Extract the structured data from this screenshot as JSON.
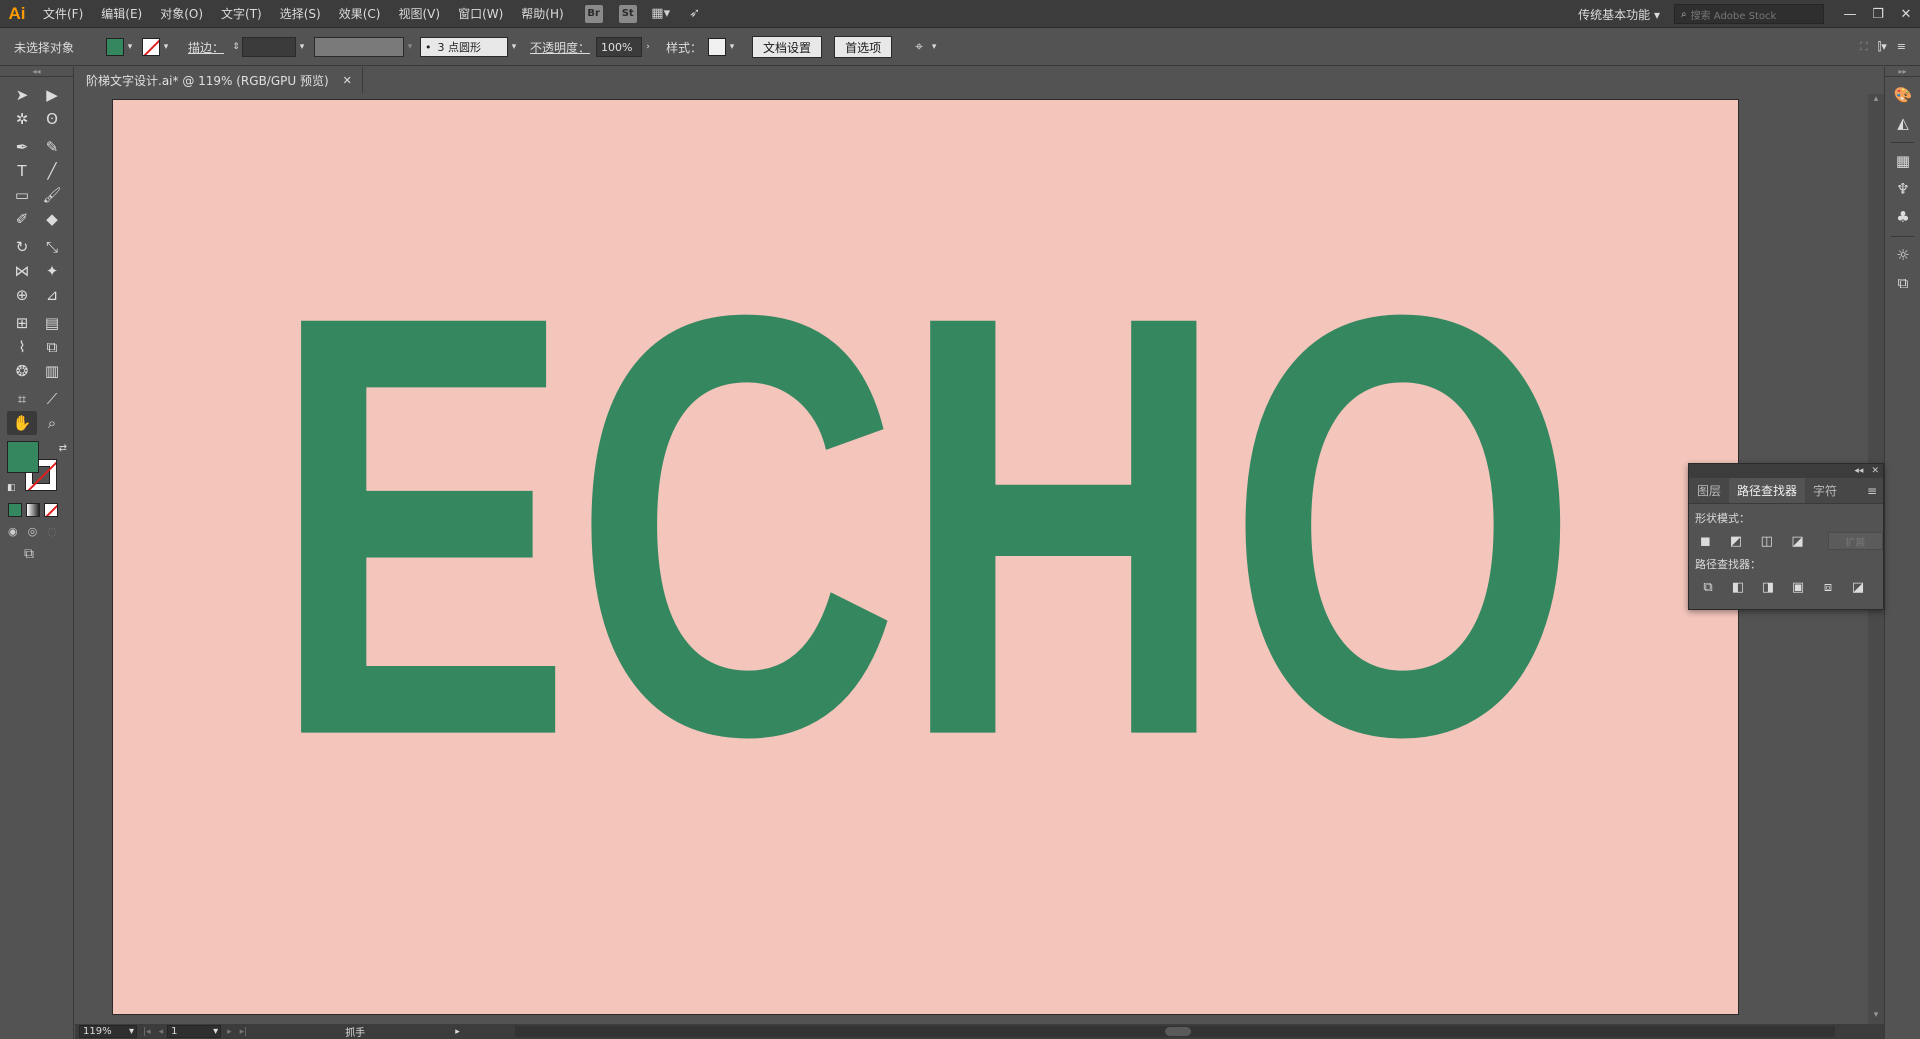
{
  "app": {
    "logo": "Ai"
  },
  "menu": {
    "items": [
      "文件(F)",
      "编辑(E)",
      "对象(O)",
      "文字(T)",
      "选择(S)",
      "效果(C)",
      "视图(V)",
      "窗口(W)",
      "帮助(H)"
    ],
    "badges": [
      "Br",
      "St"
    ]
  },
  "workspace": {
    "label": "传统基本功能",
    "search_placeholder": "搜索 Adobe Stock"
  },
  "control": {
    "selection": "未选择对象",
    "fill_color": "#358760",
    "stroke_label": "描边：",
    "brush": "3 点圆形",
    "opacity_label": "不透明度：",
    "opacity": "100%",
    "style_label": "样式：",
    "doc_setup": "文档设置",
    "preferences": "首选项"
  },
  "document": {
    "tab_title": "阶梯文字设计.ai* @ 119% (RGB/GPU 预览)",
    "artboard_color": "#f3c5bb",
    "headline": "ECHO",
    "headline_color": "#358760"
  },
  "pathfinder": {
    "tabs": [
      "图层",
      "路径查找器",
      "字符"
    ],
    "shape_modes_label": "形状模式：",
    "pathfinders_label": "路径查找器：",
    "expand": "扩展"
  },
  "status": {
    "zoom": "119%",
    "page": "1",
    "tool": "抓手"
  }
}
